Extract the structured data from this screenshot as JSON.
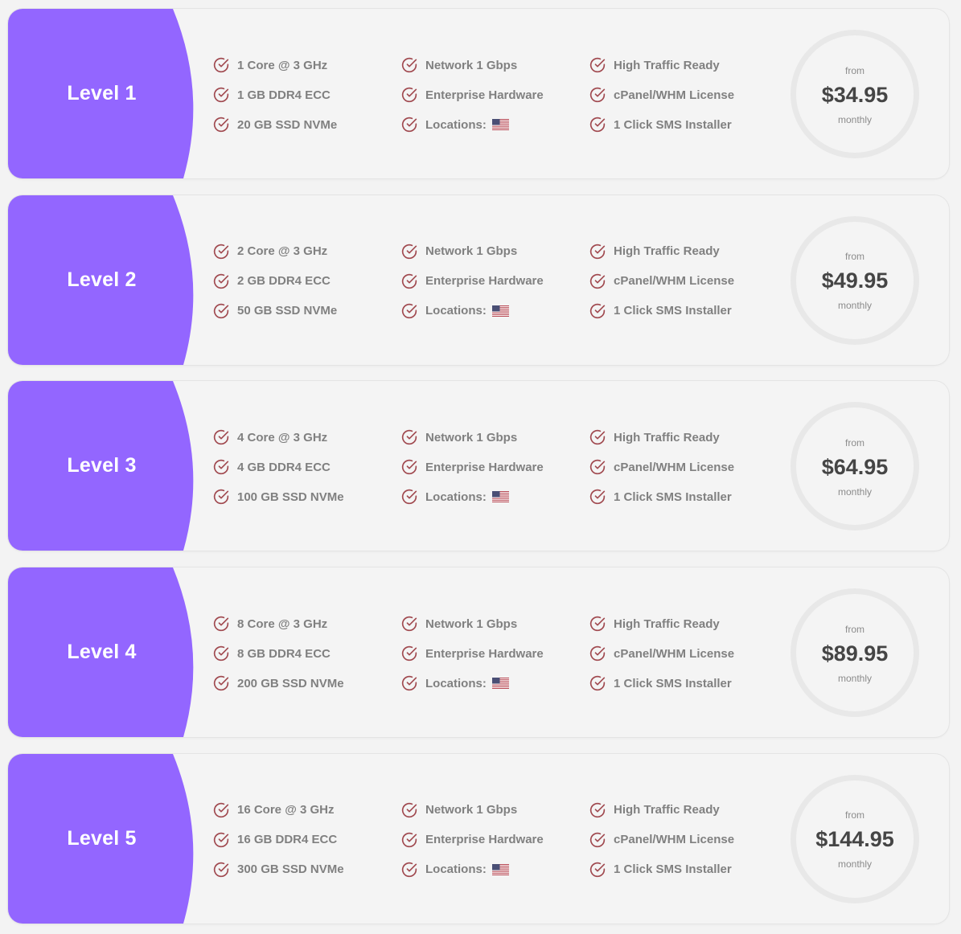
{
  "colors": {
    "accent": "#9366ff",
    "check_icon": "#a0494f",
    "feature_text": "#808080",
    "price_text": "#454545",
    "card_bg": "#f4f4f4",
    "ring": "#e8e8e8"
  },
  "plans": [
    {
      "title": "Level 1",
      "features": [
        "1 Core @ 3 GHz",
        "Network 1 Gbps",
        "High Traffic Ready",
        "1 GB DDR4 ECC",
        "Enterprise Hardware",
        "cPanel/WHM License",
        "20 GB SSD NVMe",
        "Locations:",
        "1 Click SMS Installer"
      ],
      "location_flag": "us-flag-icon",
      "price_prefix": "from",
      "price": "$34.95",
      "period": "monthly"
    },
    {
      "title": "Level 2",
      "features": [
        "2 Core @ 3 GHz",
        "Network 1 Gbps",
        "High Traffic Ready",
        "2 GB DDR4 ECC",
        "Enterprise Hardware",
        "cPanel/WHM License",
        "50 GB SSD NVMe",
        "Locations:",
        "1 Click SMS Installer"
      ],
      "location_flag": "us-flag-icon",
      "price_prefix": "from",
      "price": "$49.95",
      "period": "monthly"
    },
    {
      "title": "Level 3",
      "features": [
        "4 Core @ 3 GHz",
        "Network 1 Gbps",
        "High Traffic Ready",
        "4 GB DDR4 ECC",
        "Enterprise Hardware",
        "cPanel/WHM License",
        "100 GB SSD NVMe",
        "Locations:",
        "1 Click SMS Installer"
      ],
      "location_flag": "us-flag-icon",
      "price_prefix": "from",
      "price": "$64.95",
      "period": "monthly"
    },
    {
      "title": "Level 4",
      "features": [
        "8 Core @ 3 GHz",
        "Network 1 Gbps",
        "High Traffic Ready",
        "8 GB DDR4 ECC",
        "Enterprise Hardware",
        "cPanel/WHM License",
        "200 GB SSD NVMe",
        "Locations:",
        "1 Click SMS Installer"
      ],
      "location_flag": "us-flag-icon",
      "price_prefix": "from",
      "price": "$89.95",
      "period": "monthly"
    },
    {
      "title": "Level 5",
      "features": [
        "16 Core @ 3 GHz",
        "Network 1 Gbps",
        "High Traffic Ready",
        "16 GB DDR4 ECC",
        "Enterprise Hardware",
        "cPanel/WHM License",
        "300 GB SSD NVMe",
        "Locations:",
        "1 Click SMS Installer"
      ],
      "location_flag": "us-flag-icon",
      "price_prefix": "from",
      "price": "$144.95",
      "period": "monthly"
    }
  ]
}
